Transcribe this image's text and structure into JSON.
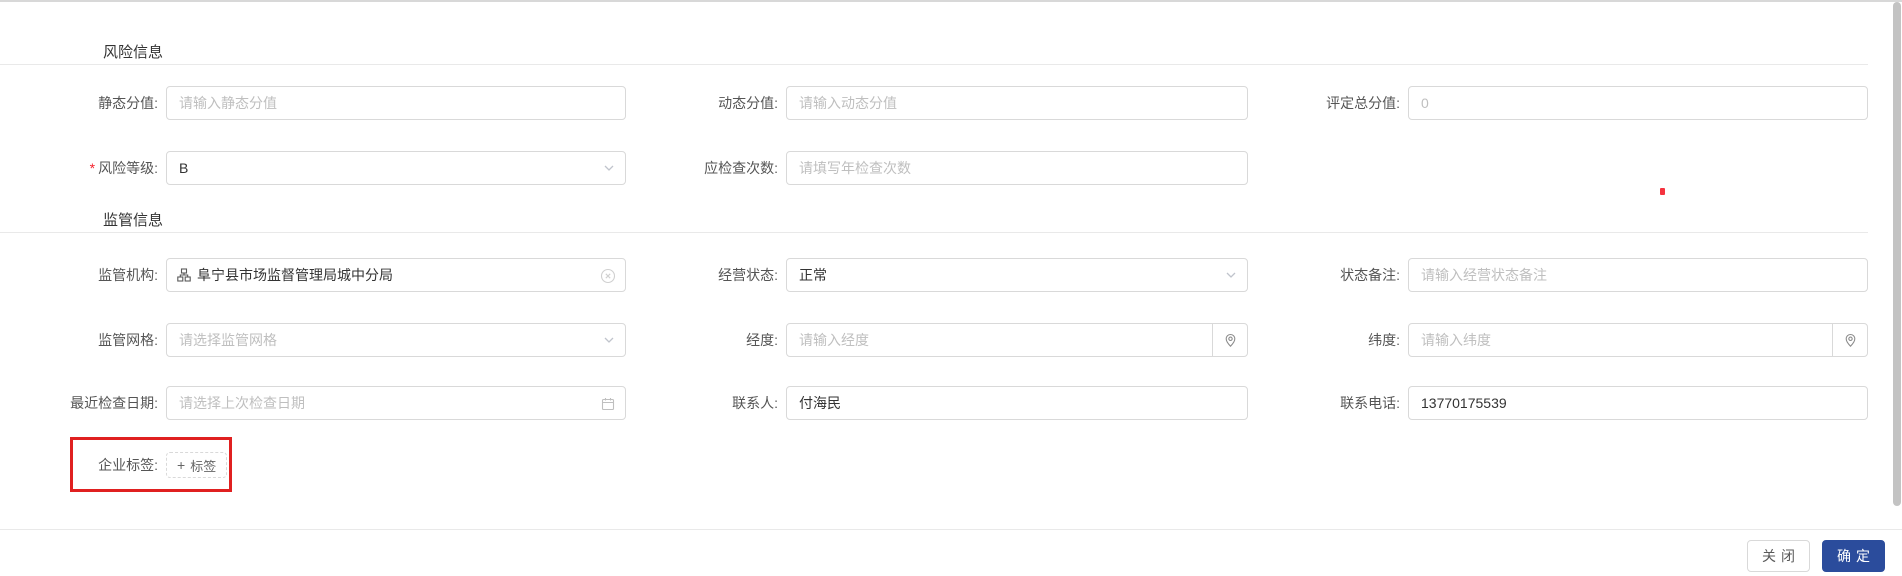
{
  "colors": {
    "confirm_button_bg": "#2b4c9c",
    "annotation_red": "#e02020",
    "red_dot": "#f5333f",
    "input_border": "#d9d9d9",
    "placeholder": "#bfbfbf",
    "required_mark": "#f5222d"
  },
  "sections": [
    {
      "title": "风险信息"
    },
    {
      "title": "监管信息"
    }
  ],
  "fields": {
    "static_score": {
      "label": "静态分值:",
      "placeholder": "请输入静态分值"
    },
    "dynamic_score": {
      "label": "动态分值:",
      "placeholder": "请输入动态分值"
    },
    "total_score": {
      "label": "评定总分值:",
      "value": "0"
    },
    "risk_level": {
      "label": "风险等级:",
      "required": "*",
      "value": "B"
    },
    "inspection_count": {
      "label": "应检查次数:",
      "placeholder": "请填写年检查次数"
    },
    "agency": {
      "label": "监管机构:",
      "value": "阜宁县市场监督管理局城中分局"
    },
    "business_status": {
      "label": "经营状态:",
      "value": "正常"
    },
    "status_remark": {
      "label": "状态备注:",
      "placeholder": "请输入经营状态备注"
    },
    "grid": {
      "label": "监管网格:",
      "placeholder": "请选择监管网格"
    },
    "longitude": {
      "label": "经度:",
      "placeholder": "请输入经度"
    },
    "latitude": {
      "label": "纬度:",
      "placeholder": "请输入纬度"
    },
    "last_inspection_date": {
      "label": "最近检查日期:",
      "placeholder": "请选择上次检查日期"
    },
    "contact": {
      "label": "联系人:",
      "value": "付海民"
    },
    "phone": {
      "label": "联系电话:",
      "value": "13770175539"
    },
    "tags": {
      "label": "企业标签:",
      "add_button": "+ 标签",
      "add_button_plus": "+",
      "add_button_text": "标签"
    }
  },
  "icons": {
    "agency_prefix": "org-chart-icon",
    "agency_clear": "clear-circle-icon",
    "select_arrow": "chevron-down-icon",
    "coordinate_suffix": "location-pin-icon",
    "date_suffix": "calendar-icon"
  },
  "footer": {
    "close": "关闭",
    "confirm": "确定"
  }
}
